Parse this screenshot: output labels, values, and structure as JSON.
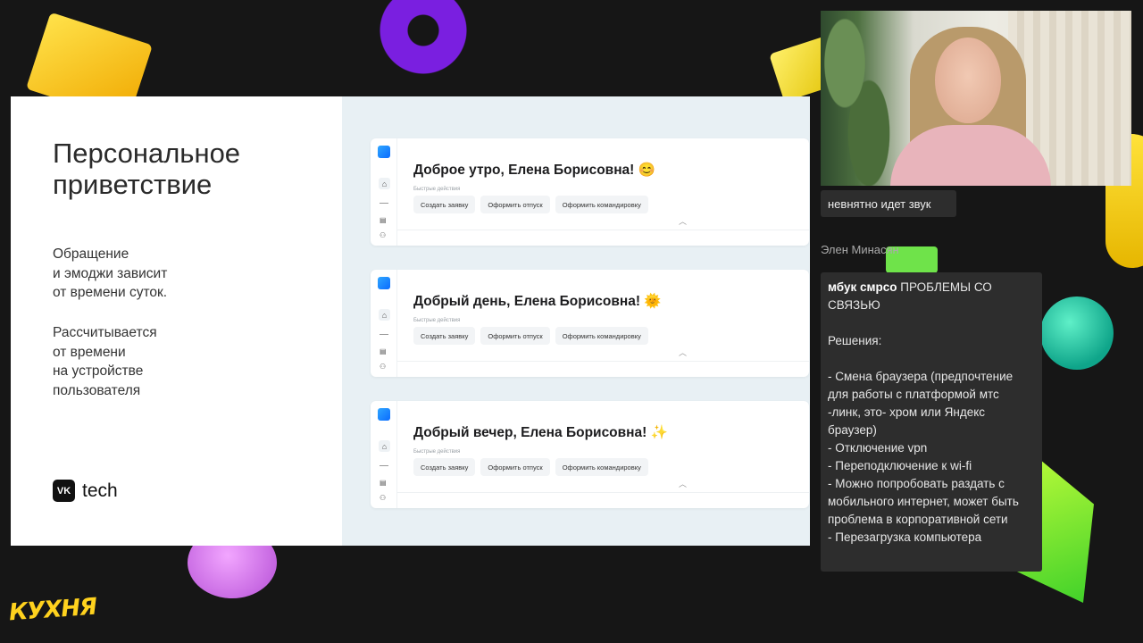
{
  "slide": {
    "title": "Персональное приветствие",
    "text1": "Обращение\nи эмоджи зависит\nот времени суток.",
    "text2": "Рассчитывается\nот времени\nна устройстве\nпользователя",
    "logo_mark": "VK",
    "logo_text": "tech"
  },
  "cards": [
    {
      "greeting": "Доброе утро, Елена Борисовна! 😊"
    },
    {
      "greeting": "Добрый день, Елена Борисовна! 🌞"
    },
    {
      "greeting": "Добрый вечер, Елена Борисовна! ✨"
    }
  ],
  "card_common": {
    "quick_actions_label": "Быстрые действия",
    "btn1": "Создать заявку",
    "btn2": "Оформить отпуск",
    "btn3": "Оформить командировку",
    "rail_icons": [
      "app-logo-icon",
      "home-icon",
      "doc-icon",
      "people-icon"
    ]
  },
  "chat": {
    "message1": "невнятно идет звук",
    "author": "Элен Минасян",
    "message2_sender": "мбук смрсо",
    "message2_body": " ПРОБЛЕМЫ СО СВЯЗЬЮ\n\nРешения:\n\n- Смена браузера (предпочтение для работы с платформой мтс -линк, это- хром или Яндекс браузер)\n- Отключение vpn\n- Переподключение к wi-fi\n- Можно попробовать раздать с мобильного интернет, может быть проблема в корпоративной сети\n- Перезагрузка компьютера"
  },
  "brand": {
    "event_logo": "КУХНЯ"
  }
}
